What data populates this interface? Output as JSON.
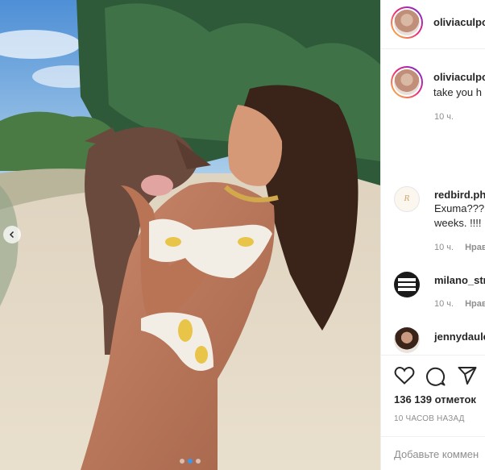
{
  "post": {
    "photo_alt": "",
    "carousel": {
      "count": 3,
      "active": 2
    }
  },
  "header": {
    "username": "oliviaculpo"
  },
  "caption": {
    "username": "oliviaculpo",
    "text": "take you h",
    "time": "10 ч."
  },
  "comments": [
    {
      "username": "redbird.ph",
      "text1": "Exuma???",
      "text2": "weeks. !!!!",
      "time": "10 ч.",
      "reply": "Нрав",
      "avatar": "redbird-avatar"
    },
    {
      "username": "milano_stre",
      "text1": "",
      "text2": "",
      "time": "10 ч.",
      "reply": "Нрав",
      "avatar": "milano-fashion-week-avatar"
    },
    {
      "username": "jennydaule",
      "text1": "",
      "text2": "",
      "time": "",
      "reply": "",
      "avatar": "jennydaule-avatar"
    }
  ],
  "actions": {
    "likes": "136 139 отметок",
    "posted": "10 ЧАСОВ НАЗАД",
    "add_comment_placeholder": "Добавьте коммен",
    "icons": [
      "heart-icon",
      "comment-icon",
      "share-icon"
    ]
  },
  "colors": {
    "accent": "#3897f0",
    "text": "#262626",
    "muted": "#8e8e8e",
    "border": "#efefef"
  }
}
